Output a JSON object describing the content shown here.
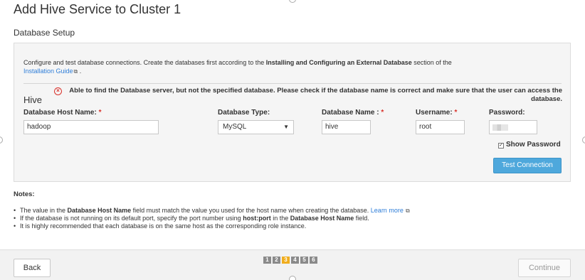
{
  "page": {
    "title": "Add Hive Service to Cluster 1",
    "section": "Database Setup"
  },
  "panel": {
    "intro_before": "Configure and test database connections. Create the databases first according to the ",
    "intro_bold": "Installing and Configuring an External Database",
    "intro_after": " section of the",
    "guide_link": "Installation Guide",
    "guide_link_suffix": " .",
    "service": "Hive",
    "error_message": "Able to find the Database server, but not the specified database. Please check if the database name is correct and make sure that the user can access the database.",
    "fields": {
      "host": {
        "label": "Database Host Name:",
        "required": "*",
        "value": "hadoop"
      },
      "type": {
        "label": "Database Type:",
        "value": "MySQL"
      },
      "name": {
        "label": "Database Name :",
        "required": "*",
        "value": "hive"
      },
      "user": {
        "label": "Username:",
        "required": "*",
        "value": "root"
      },
      "password": {
        "label": "Password:"
      }
    },
    "show_password": "Show Password",
    "show_password_checked": true,
    "test_button": "Test Connection"
  },
  "notes": {
    "title": "Notes:",
    "n1_before": "The value in the ",
    "n1_bold": "Database Host Name",
    "n1_after": " field must match the value you used for the host name when creating the database. ",
    "n1_link": "Learn more",
    "n2_before": "If the database is not running on its default port, specify the port number using ",
    "n2_bold1": "host:port",
    "n2_mid": " in the ",
    "n2_bold2": "Database Host Name",
    "n2_after": " field.",
    "n3": "It is highly recommended that each database is on the same host as the corresponding role instance."
  },
  "footer": {
    "back": "Back",
    "continue": "Continue",
    "steps": [
      "1",
      "2",
      "3",
      "4",
      "5",
      "6"
    ],
    "current_step": 3
  },
  "colors": {
    "accent": "#4ea8dc",
    "error": "#d9312a",
    "link": "#2f7ed8",
    "step_active": "#f0ad1e"
  }
}
